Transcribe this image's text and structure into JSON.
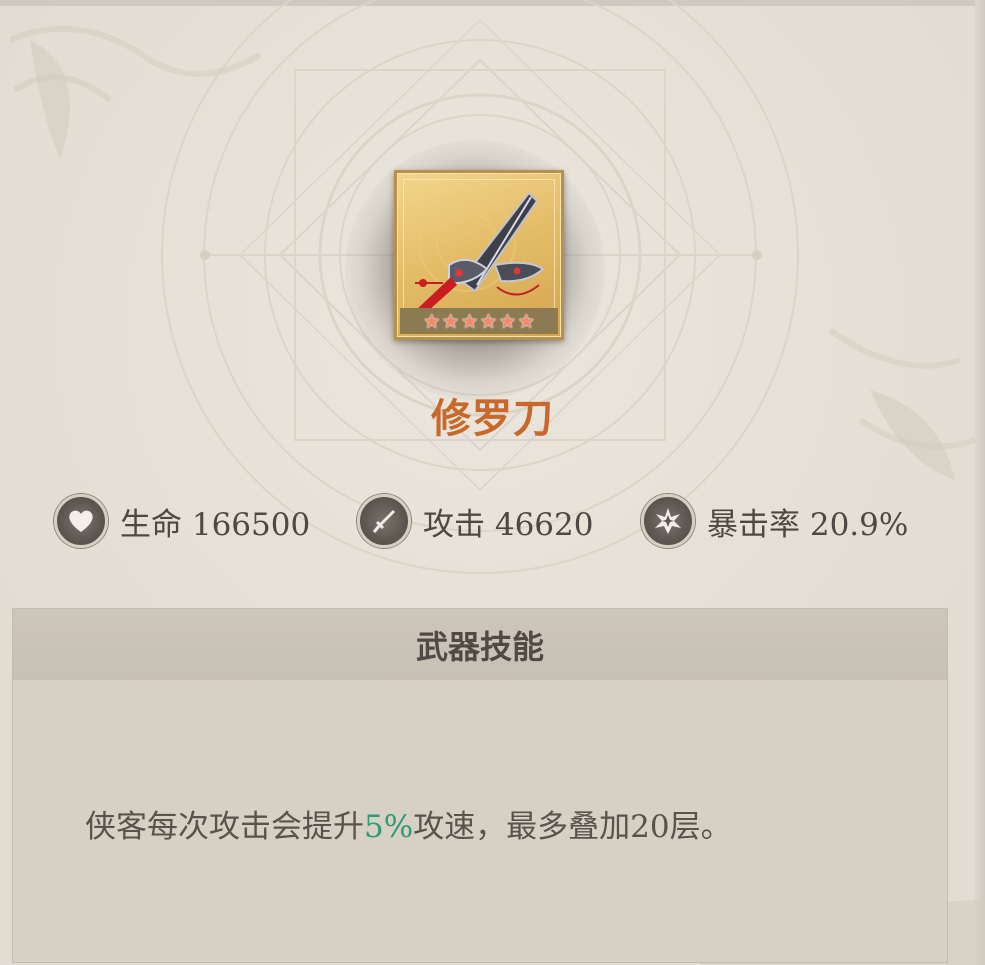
{
  "item": {
    "name": "修罗刀",
    "stars": 6,
    "icon": "sword-icon"
  },
  "stats": [
    {
      "label": "生命",
      "value": "166500",
      "icon": "heart-icon"
    },
    {
      "label": "攻击",
      "value": "46620",
      "icon": "sword-attack-icon"
    },
    {
      "label": "暴击率",
      "value": "20.9%",
      "icon": "crit-burst-icon"
    }
  ],
  "skill": {
    "title": "武器技能",
    "desc_before": "侠客每次攻击会提升",
    "desc_highlight": "5%",
    "desc_after": "攻速，最多叠加20层。"
  },
  "colors": {
    "name": "#c8682a",
    "highlight": "#2f9a78",
    "frame_gold": "#b8904a"
  }
}
